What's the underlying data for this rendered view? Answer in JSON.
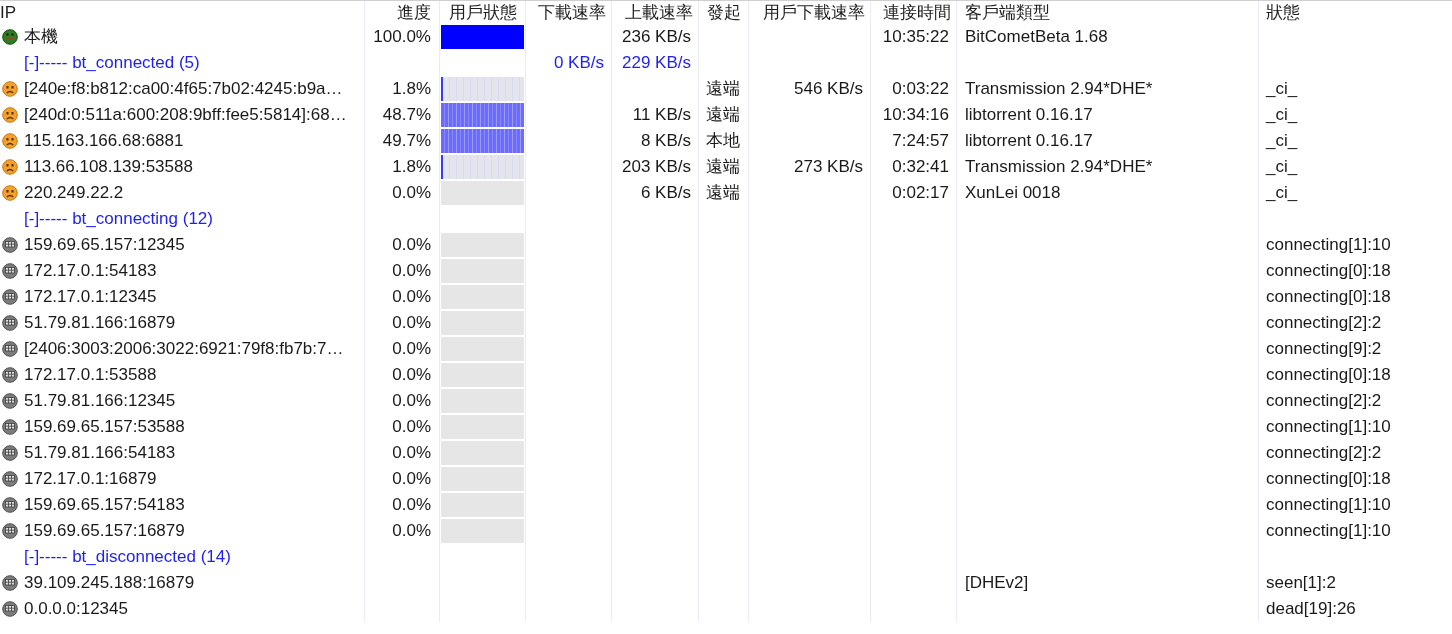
{
  "table": {
    "columns": [
      "IP",
      "進度",
      "用戶狀態",
      "下載速率",
      "上載速率",
      "發起",
      "用戶下載速率",
      "連接時間",
      "客戶端類型",
      "狀態"
    ],
    "rows": [
      {
        "kind": "peer",
        "face": {
          "kind": "smiling"
        },
        "ip": "本機",
        "progress": "100.0%",
        "pieces": {
          "kind": "full"
        },
        "upload": "236 KB/s",
        "connected_time": "10:35:22",
        "client": "BitCometBeta 1.68"
      },
      {
        "kind": "group",
        "label": "[-]----- bt_connected (5)",
        "download": "0 KB/s",
        "upload": "229 KB/s",
        "children": [
          {
            "kind": "peer",
            "face": {
              "kind": "frowning"
            },
            "ip": "[240e:f8:b812:ca00:4f65:7b02:4245:b9a…",
            "progress": "1.8%",
            "pieces": {
              "kind": "sparse"
            },
            "initiator": "遠端",
            "peer_download": "546 KB/s",
            "connected_time": "0:03:22",
            "client": "Transmission 2.94*DHE*",
            "status": "_ci_"
          },
          {
            "kind": "peer",
            "face": {
              "kind": "frowning"
            },
            "ip": "[240d:0:511a:600:208:9bff:fee5:5814]:68…",
            "progress": "48.7%",
            "pieces": {
              "kind": "dense"
            },
            "upload": "11 KB/s",
            "initiator": "遠端",
            "connected_time": "10:34:16",
            "client": "libtorrent 0.16.17",
            "status": "_ci_"
          },
          {
            "kind": "peer",
            "face": {
              "kind": "frowning"
            },
            "ip": "115.163.166.68:6881",
            "progress": "49.7%",
            "pieces": {
              "kind": "dense"
            },
            "upload": "8 KB/s",
            "initiator": "本地",
            "connected_time": "7:24:57",
            "client": "libtorrent 0.16.17",
            "status": "_ci_"
          },
          {
            "kind": "peer",
            "face": {
              "kind": "frowning"
            },
            "ip": "113.66.108.139:53588",
            "progress": "1.8%",
            "pieces": {
              "kind": "sparse"
            },
            "upload": "203 KB/s",
            "initiator": "遠端",
            "peer_download": "273 KB/s",
            "connected_time": "0:32:41",
            "client": "Transmission 2.94*DHE*",
            "status": "_ci_"
          },
          {
            "kind": "peer",
            "face": {
              "kind": "frowning"
            },
            "ip": "220.249.22.2",
            "progress": "0.0%",
            "pieces": {
              "kind": "empty"
            },
            "upload": "6 KB/s",
            "initiator": "遠端",
            "connected_time": "0:02:17",
            "client": "XunLei 0018",
            "status": "_ci_"
          }
        ]
      },
      {
        "kind": "group",
        "label": "[-]----- bt_connecting (12)",
        "children": [
          {
            "kind": "peer",
            "face": {
              "kind": "grimacing"
            },
            "ip": "159.69.65.157:12345",
            "progress": "0.0%",
            "pieces": {
              "kind": "empty"
            },
            "status": "connecting[1]:10"
          },
          {
            "kind": "peer",
            "face": {
              "kind": "grimacing"
            },
            "ip": "172.17.0.1:54183",
            "progress": "0.0%",
            "pieces": {
              "kind": "empty"
            },
            "status": "connecting[0]:18"
          },
          {
            "kind": "peer",
            "face": {
              "kind": "grimacing"
            },
            "ip": "172.17.0.1:12345",
            "progress": "0.0%",
            "pieces": {
              "kind": "empty"
            },
            "status": "connecting[0]:18"
          },
          {
            "kind": "peer",
            "face": {
              "kind": "grimacing"
            },
            "ip": "51.79.81.166:16879",
            "progress": "0.0%",
            "pieces": {
              "kind": "empty"
            },
            "status": "connecting[2]:2"
          },
          {
            "kind": "peer",
            "face": {
              "kind": "grimacing"
            },
            "ip": "[2406:3003:2006:3022:6921:79f8:fb7b:7…",
            "progress": "0.0%",
            "pieces": {
              "kind": "empty"
            },
            "status": "connecting[9]:2"
          },
          {
            "kind": "peer",
            "face": {
              "kind": "grimacing"
            },
            "ip": "172.17.0.1:53588",
            "progress": "0.0%",
            "pieces": {
              "kind": "empty"
            },
            "status": "connecting[0]:18"
          },
          {
            "kind": "peer",
            "face": {
              "kind": "grimacing"
            },
            "ip": "51.79.81.166:12345",
            "progress": "0.0%",
            "pieces": {
              "kind": "empty"
            },
            "status": "connecting[2]:2"
          },
          {
            "kind": "peer",
            "face": {
              "kind": "grimacing"
            },
            "ip": "159.69.65.157:53588",
            "progress": "0.0%",
            "pieces": {
              "kind": "empty"
            },
            "status": "connecting[1]:10"
          },
          {
            "kind": "peer",
            "face": {
              "kind": "grimacing"
            },
            "ip": "51.79.81.166:54183",
            "progress": "0.0%",
            "pieces": {
              "kind": "empty"
            },
            "status": "connecting[2]:2"
          },
          {
            "kind": "peer",
            "face": {
              "kind": "grimacing"
            },
            "ip": "172.17.0.1:16879",
            "progress": "0.0%",
            "pieces": {
              "kind": "empty"
            },
            "status": "connecting[0]:18"
          },
          {
            "kind": "peer",
            "face": {
              "kind": "grimacing"
            },
            "ip": "159.69.65.157:54183",
            "progress": "0.0%",
            "pieces": {
              "kind": "empty"
            },
            "status": "connecting[1]:10"
          },
          {
            "kind": "peer",
            "face": {
              "kind": "grimacing"
            },
            "ip": "159.69.65.157:16879",
            "progress": "0.0%",
            "pieces": {
              "kind": "empty"
            },
            "status": "connecting[1]:10"
          }
        ]
      },
      {
        "kind": "group",
        "label": "[-]----- bt_disconnected (14)",
        "children": [
          {
            "kind": "peer",
            "face": {
              "kind": "grimacing"
            },
            "ip": "39.109.245.188:16879",
            "client": "[DHEv2]",
            "status": "seen[1]:2"
          },
          {
            "kind": "peer",
            "face": {
              "kind": "grimacing"
            },
            "ip": "0.0.0.0:12345",
            "status": "dead[19]:26"
          }
        ]
      }
    ]
  }
}
